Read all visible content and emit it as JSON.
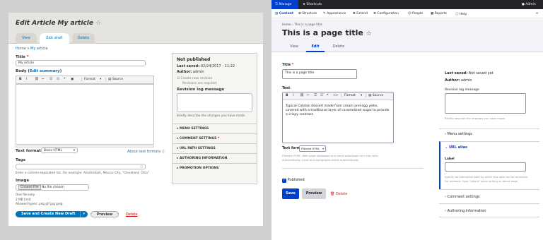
{
  "left": {
    "title": "Edit Article My article",
    "tabs": [
      "View",
      "Edit draft",
      "Delete"
    ],
    "breadcrumb": {
      "home": "Home",
      "sep": " » ",
      "item": "My article"
    },
    "title_label": "Title",
    "title_value": "My article",
    "body_label": "Body",
    "body_summary_link": "Edit summary",
    "toolbar": {
      "bold": "B",
      "italic": "I",
      "format": "Format",
      "source": "Source"
    },
    "text_format_label": "Text format",
    "text_format_value": "Basic HTML",
    "about_formats": "About text formats",
    "tags_label": "Tags",
    "tags_help": "Enter a comma-separated list. For example: Amsterdam, Mexico City, \"Cleveland, Ohio\"",
    "image_label": "Image",
    "choose_file": "Choose File",
    "no_file": "No file chosen",
    "image_help": [
      "One file only",
      "2 MB limit",
      "Allowed types: png gif jpg jpeg."
    ],
    "save_button": "Save and Create New Draft",
    "preview_button": "Preview",
    "delete_link": "Delete",
    "sidebar": {
      "status": "Not published",
      "last_saved_label": "Last saved:",
      "last_saved": "02/24/2017 - 11:22",
      "author_label": "Author:",
      "author": "admin",
      "new_revision": "Create new revision",
      "revisions_required": "Revisions are required.",
      "revlog_label": "Revision log message",
      "revlog_help": "Briefly describe the changes you have made.",
      "sections": [
        "MENU SETTINGS",
        "COMMENT SETTINGS",
        "URL PATH SETTINGS",
        "AUTHORING INFORMATION",
        "PROMOTION OPTIONS"
      ]
    }
  },
  "right": {
    "toolbar_top": {
      "manage": "Manage",
      "shortcuts": "Shortcuts",
      "admin": "Admin"
    },
    "menu": [
      "Content",
      "Structure",
      "Appearance",
      "Extend",
      "Configuration",
      "People",
      "Reports",
      "Help"
    ],
    "breadcrumb": {
      "home": "Home",
      "sep": " › ",
      "item": "This is a page title"
    },
    "page_title": "This is a page title",
    "tabs": [
      "View",
      "Edit",
      "Delete"
    ],
    "title_label": "Title",
    "title_value": "This is a page title",
    "text_label": "Text",
    "toolbar": {
      "bold": "B",
      "italic": "I",
      "format": "Format",
      "source": "Source"
    },
    "body_text": "Typical Catalan dessert made from cream and egg yolks, covered with a traditional layer of caramelized sugar to provide a crispy contrast.",
    "text_format_label": "Text format",
    "text_format_value": "Filtered HTML",
    "text_format_help": "Filtered HTML: Web page addresses and email addresses turn into links automatically. Lines and paragraphs break automatically.",
    "published_label": "Published",
    "save_button": "Save",
    "preview_button": "Preview",
    "delete_link": "Delete",
    "sidebar": {
      "last_saved_label": "Last saved:",
      "last_saved": "Not saved yet",
      "author_label": "Author:",
      "author": "admin",
      "revlog_label": "Revision log message",
      "revlog_help": "Briefly describe the changes you have made.",
      "menu_settings": "Menu settings",
      "url_alias": "URL alias",
      "label_label": "Label",
      "url_help": "Specify an alternative path by which this data can be accessed. For example, type \"/about\" when writing an about page.",
      "comment_settings": "Comment settings",
      "authoring": "Authoring information"
    }
  },
  "colors": {
    "claro_blue": "#003ecc",
    "seven_blue": "#0074bd",
    "delete_red": "#d72222",
    "toolbar_dark": "#23232a"
  }
}
